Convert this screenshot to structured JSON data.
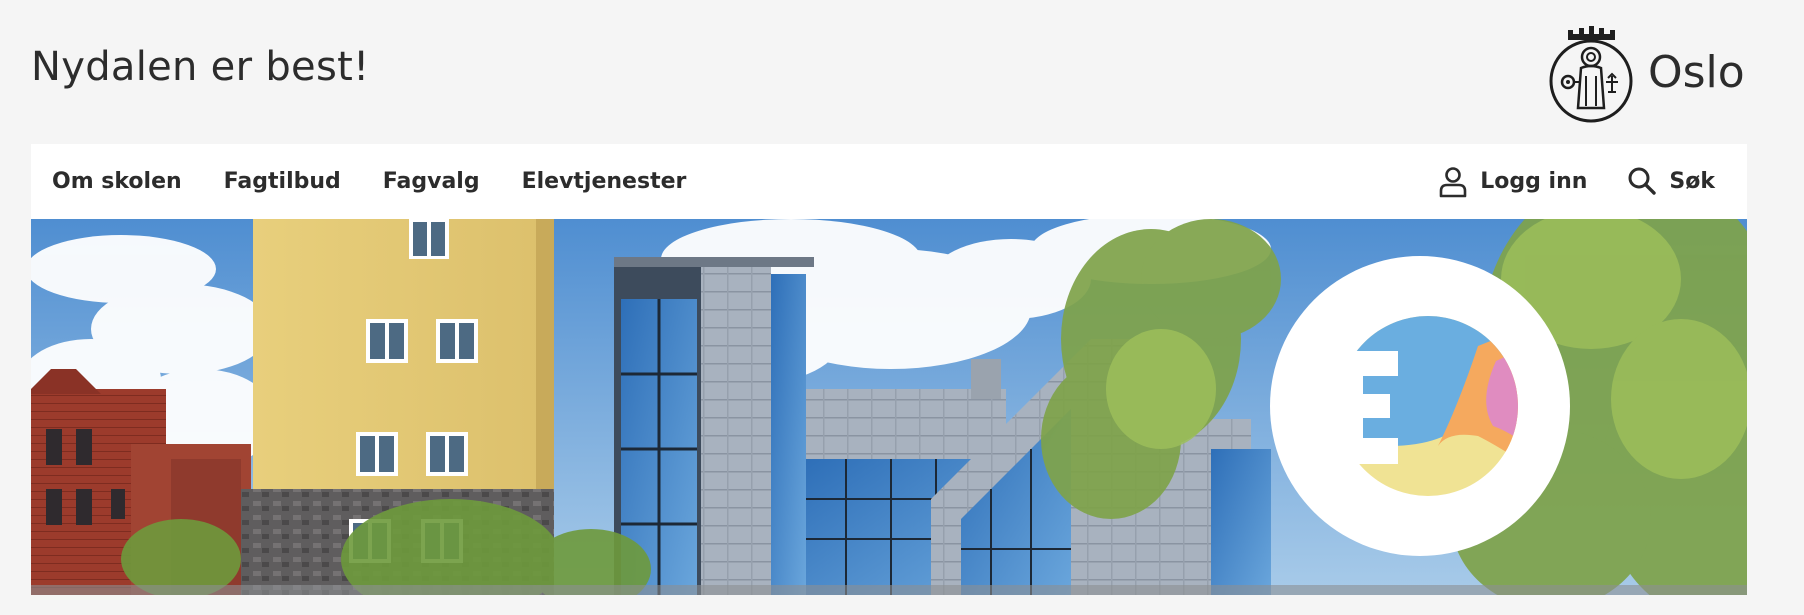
{
  "header": {
    "site_title": "Nydalen er best!",
    "logo_text": "Oslo",
    "logo_icon": "oslo-seal-icon"
  },
  "nav": {
    "items": [
      {
        "label": "Om skolen"
      },
      {
        "label": "Fagtilbud"
      },
      {
        "label": "Fagvalg"
      },
      {
        "label": "Elevtjenester"
      }
    ],
    "login_label": "Logg inn",
    "login_icon": "user-icon",
    "search_label": "Søk",
    "search_icon": "search-icon"
  },
  "hero": {
    "image": "school-building-photo",
    "badge_icon": "school-logo-e-icon"
  },
  "colors": {
    "page_bg": "#f5f5f5",
    "nav_bg": "#ffffff",
    "text": "#2c2c2c",
    "badge_blue": "#6aaee0",
    "badge_orange": "#f5a95e",
    "badge_pink": "#e08cc0",
    "badge_yellow": "#f0e394"
  }
}
